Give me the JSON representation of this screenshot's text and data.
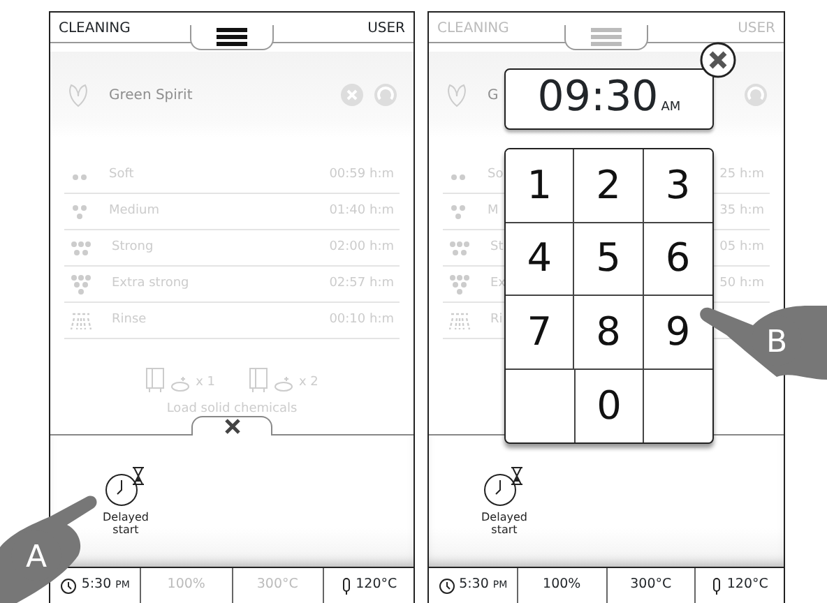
{
  "screens": [
    {
      "header": {
        "left": "CLEANING",
        "right": "USER",
        "dimmed": false
      },
      "program": {
        "name": "Green Spirit",
        "actions": [
          {
            "kind": "cancel"
          },
          {
            "kind": "start"
          }
        ]
      },
      "rows": [
        {
          "kind": "soft",
          "label": "Soft",
          "time": "00:59 h:m"
        },
        {
          "kind": "medium",
          "label": "Medium",
          "time": "01:40 h:m"
        },
        {
          "kind": "strong",
          "label": "Strong",
          "time": "02:00 h:m"
        },
        {
          "kind": "extra",
          "label": "Extra strong",
          "time": "02:57 h:m"
        },
        {
          "kind": "rinse",
          "label": "Rinse",
          "time": "00:10 h:m"
        }
      ],
      "chemicals": [
        {
          "count": "x 1"
        },
        {
          "count": "x 2"
        }
      ],
      "chemicals_caption": "Load solid chemicals",
      "drawer": {
        "closable": true,
        "action": "Delayed start"
      },
      "status": [
        {
          "kind": "clock",
          "text": "5:30",
          "suffix": "PM",
          "enabled": true
        },
        {
          "kind": "plain",
          "text": "100%",
          "enabled": false
        },
        {
          "kind": "plain",
          "text": "300°C",
          "enabled": false
        },
        {
          "kind": "probe",
          "text": "120°C",
          "enabled": true
        }
      ],
      "pointer": "A"
    },
    {
      "header": {
        "left": "CLEANING",
        "right": "USER",
        "dimmed": true
      },
      "program": {
        "name": "G",
        "actions": [
          {
            "kind": "start"
          }
        ]
      },
      "rows": [
        {
          "kind": "soft",
          "label": "So",
          "time": "25 h:m"
        },
        {
          "kind": "medium",
          "label": "M",
          "time": "35 h:m"
        },
        {
          "kind": "strong",
          "label": "St",
          "time": "05 h:m"
        },
        {
          "kind": "extra",
          "label": "Ex",
          "time": "50 h:m"
        },
        {
          "kind": "rinse",
          "label": "Ri"
        }
      ],
      "drawer": {
        "action": "Delayed start"
      },
      "dialog": {
        "time": "09:30",
        "meridiem": "AM",
        "keys": [
          "1",
          "2",
          "3",
          "4",
          "5",
          "6",
          "7",
          "8",
          "9",
          "0"
        ]
      },
      "status": [
        {
          "kind": "clock",
          "text": "5:30",
          "suffix": "PM",
          "enabled": true
        },
        {
          "kind": "plain",
          "text": "100%",
          "enabled": true
        },
        {
          "kind": "plain",
          "text": "300°C",
          "enabled": true
        },
        {
          "kind": "probe",
          "text": "120°C",
          "enabled": true
        }
      ],
      "pointer": "B"
    }
  ]
}
